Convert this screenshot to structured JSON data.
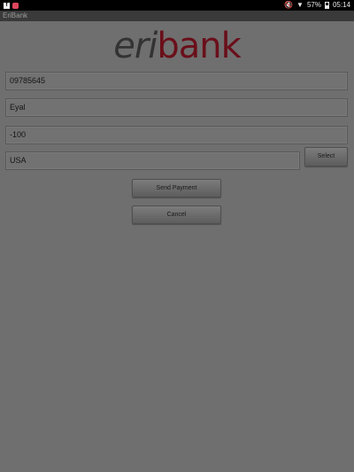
{
  "status_bar": {
    "battery": "57%",
    "time": "05:14",
    "icons": [
      "facebook-notification-icon",
      "app-notification-icon",
      "mute-icon",
      "wifi-icon",
      "battery-icon"
    ]
  },
  "app": {
    "title": "EriBank"
  },
  "logo": {
    "part1": "eri",
    "part2": "bank"
  },
  "form": {
    "account_value": "09785645",
    "name_value": "Eyal",
    "amount_value": "-100",
    "country_value": "USA",
    "select_label": "Select",
    "send_label": "Send Payment",
    "cancel_label": "Cancel"
  }
}
